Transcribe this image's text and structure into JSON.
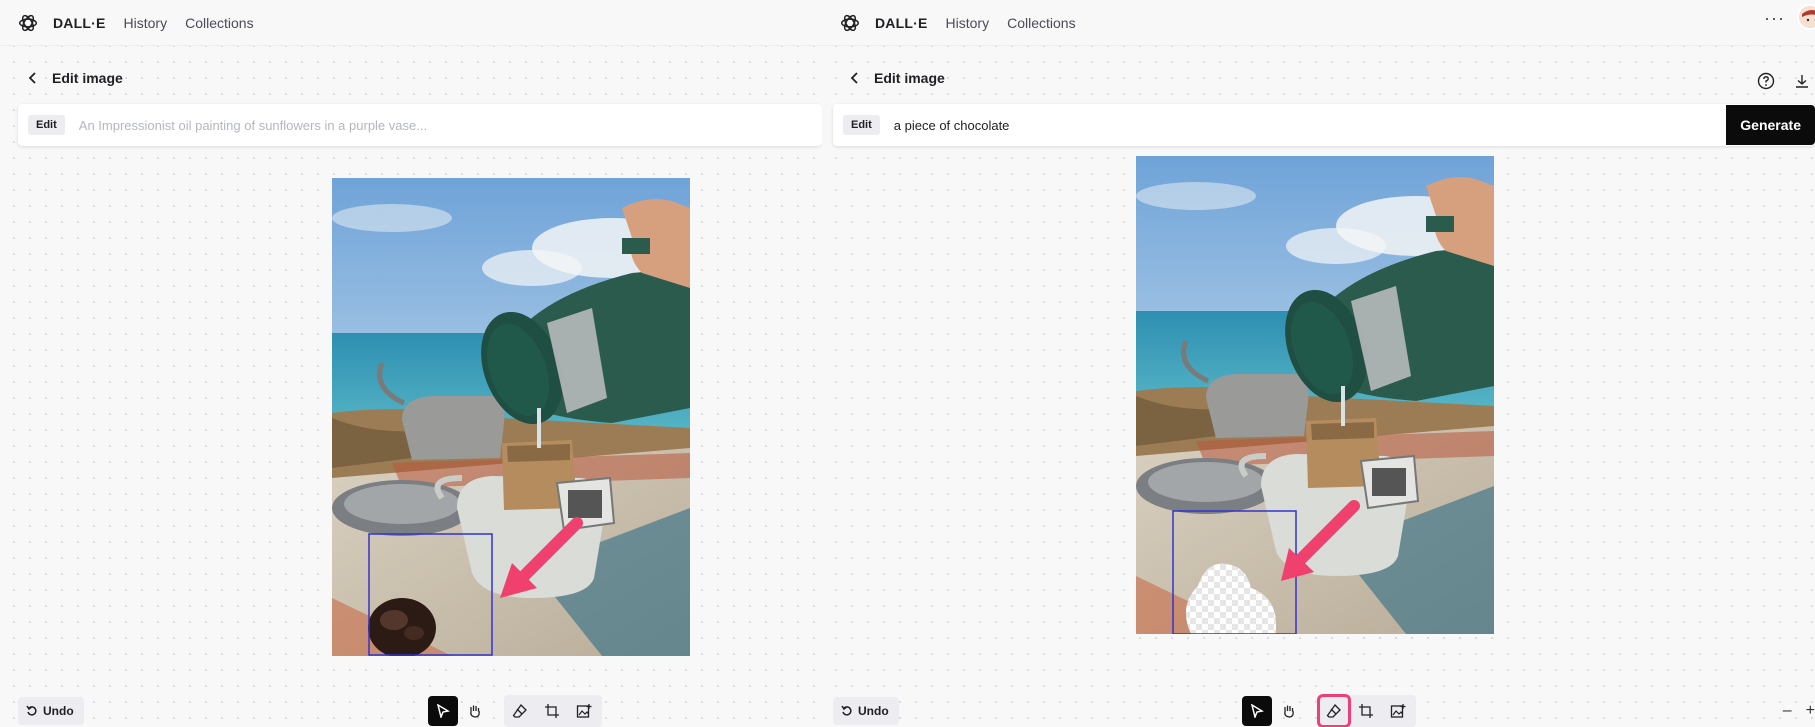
{
  "left": {
    "nav": {
      "brand": "DALL·E",
      "history": "History",
      "collections": "Collections"
    },
    "edit_title": "Edit image",
    "edit_tag": "Edit",
    "prompt_placeholder": "An Impressionist oil painting of sunflowers in a purple vase...",
    "undo_label": "Undo",
    "tools": [
      "select-icon",
      "hand-icon",
      "eraser-icon",
      "crop-icon",
      "add-image-icon"
    ]
  },
  "right": {
    "nav": {
      "brand": "DALL·E",
      "history": "History",
      "collections": "Collections"
    },
    "edit_title": "Edit image",
    "edit_tag": "Edit",
    "prompt_value": "a piece of chocolate",
    "generate_label": "Generate",
    "undo_label": "Undo",
    "more": "···",
    "zoom_out": "–",
    "zoom_in": "+",
    "tools": [
      "select-icon",
      "hand-icon",
      "eraser-icon",
      "crop-icon",
      "add-image-icon"
    ]
  },
  "colors": {
    "accent_dark": "#0b0b0c",
    "highlight": "#ee3f78",
    "selection_box": "#3333cc",
    "arrow": "#f0406e"
  }
}
